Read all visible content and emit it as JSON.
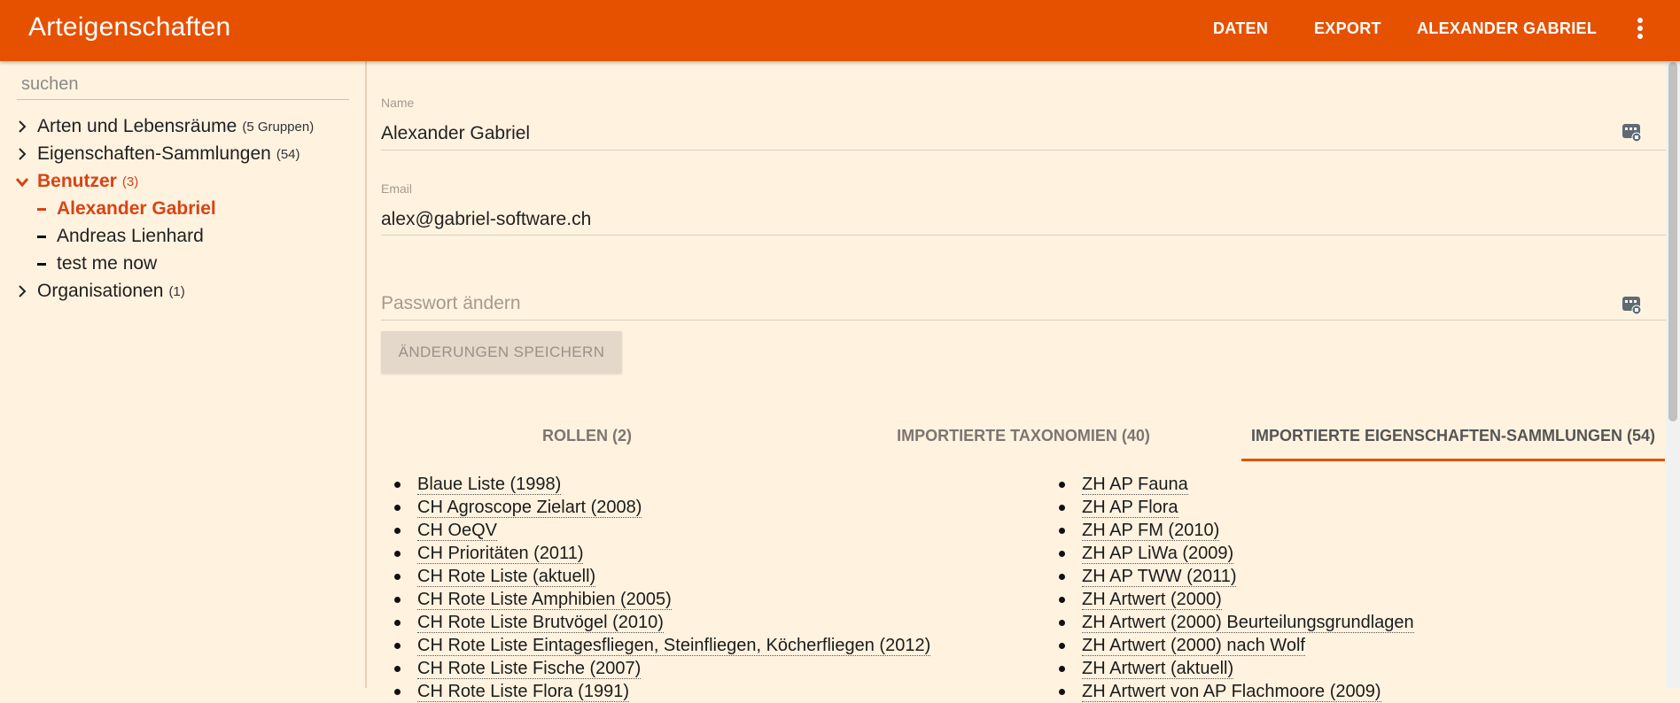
{
  "app": {
    "title": "Arteigenschaften"
  },
  "nav": {
    "daten": "DATEN",
    "export": "EXPORT",
    "user": "ALEXANDER GABRIEL"
  },
  "sidebar": {
    "search_placeholder": "suchen",
    "tree": [
      {
        "label": "Arten und Lebensräume",
        "count": "(5 Gruppen)"
      },
      {
        "label": "Eigenschaften-Sammlungen",
        "count": "(54)"
      },
      {
        "label": "Benutzer",
        "count": "(3)",
        "children": [
          "Alexander Gabriel",
          "Andreas Lienhard",
          "test me now"
        ]
      },
      {
        "label": "Organisationen",
        "count": "(1)"
      }
    ]
  },
  "form": {
    "name_label": "Name",
    "name_value": "Alexander Gabriel",
    "email_label": "Email",
    "email_value": "alex@gabriel-software.ch",
    "password_placeholder": "Passwort ändern",
    "save_label": "ÄNDERUNGEN SPEICHERN"
  },
  "tabs": [
    {
      "label": "ROLLEN (2)"
    },
    {
      "label": "IMPORTIERTE TAXONOMIEN (40)"
    },
    {
      "label": "IMPORTIERTE EIGENSCHAFTEN-SAMMLUNGEN (54)",
      "active": true
    }
  ],
  "collections_left": [
    "Blaue Liste (1998)",
    "CH Agroscope Zielart (2008)",
    "CH OeQV",
    "CH Prioritäten (2011)",
    "CH Rote Liste (aktuell)",
    "CH Rote Liste Amphibien (2005)",
    "CH Rote Liste Brutvögel (2010)",
    "CH Rote Liste Eintagesfliegen, Steinfliegen, Köcherfliegen (2012)",
    "CH Rote Liste Fische (2007)",
    "CH Rote Liste Flora (1991)"
  ],
  "collections_right": [
    "ZH AP Fauna",
    "ZH AP Flora",
    "ZH AP FM (2010)",
    "ZH AP LiWa (2009)",
    "ZH AP TWW (2011)",
    "ZH Artwert (2000)",
    "ZH Artwert (2000) Beurteilungsgrundlagen",
    "ZH Artwert (2000) nach Wolf",
    "ZH Artwert (aktuell)",
    "ZH Artwert von AP Flachmoore (2009)"
  ],
  "colors": {
    "accent": "#e65100",
    "active": "#d84315",
    "background": "#fff3e0"
  },
  "icons": {
    "field_icon": "keyboard-icon",
    "menu_icon": "more-vert-icon",
    "tree_collapsed": "chevron-right-icon",
    "tree_expanded": "chevron-down-icon"
  }
}
